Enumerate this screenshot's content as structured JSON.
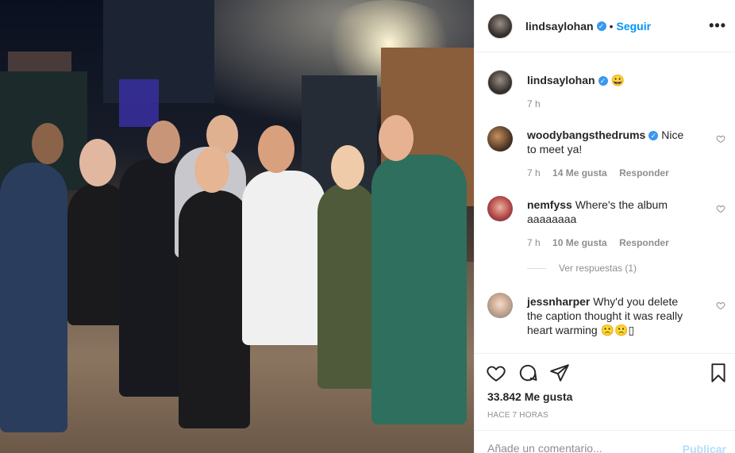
{
  "post": {
    "username": "lindsaylohan",
    "follow_label": "Seguir",
    "more_label": "•••",
    "caption_emoji": "😀",
    "caption_time": "7 h"
  },
  "comments": [
    {
      "username": "woodybangsthedrums",
      "verified": true,
      "text": "Nice to meet ya!",
      "time": "7 h",
      "likes": "14 Me gusta",
      "reply_label": "Responder"
    },
    {
      "username": "nemfyss",
      "verified": false,
      "text": "Where's the album aaaaaaaa",
      "time": "7 h",
      "likes": "10 Me gusta",
      "reply_label": "Responder"
    },
    {
      "username": "jessnharper",
      "verified": false,
      "text": "Why'd you delete the caption thought it was really heart warming 🙁🙁▯"
    }
  ],
  "view_replies": "Ver respuestas (1)",
  "actions": {
    "like_icon": "heart-icon",
    "comment_icon": "comment-icon",
    "share_icon": "share-icon",
    "save_icon": "bookmark-icon"
  },
  "likes_count": "33.842 Me gusta",
  "posted_ago": "Hace 7 horas",
  "add_comment": {
    "placeholder": "Añade un comentario...",
    "publish_label": "Publicar"
  },
  "colors": {
    "accent": "#0095f6",
    "verified": "#3897f0",
    "publish_disabled": "#b2dffc",
    "muted": "#8e8e8e"
  }
}
